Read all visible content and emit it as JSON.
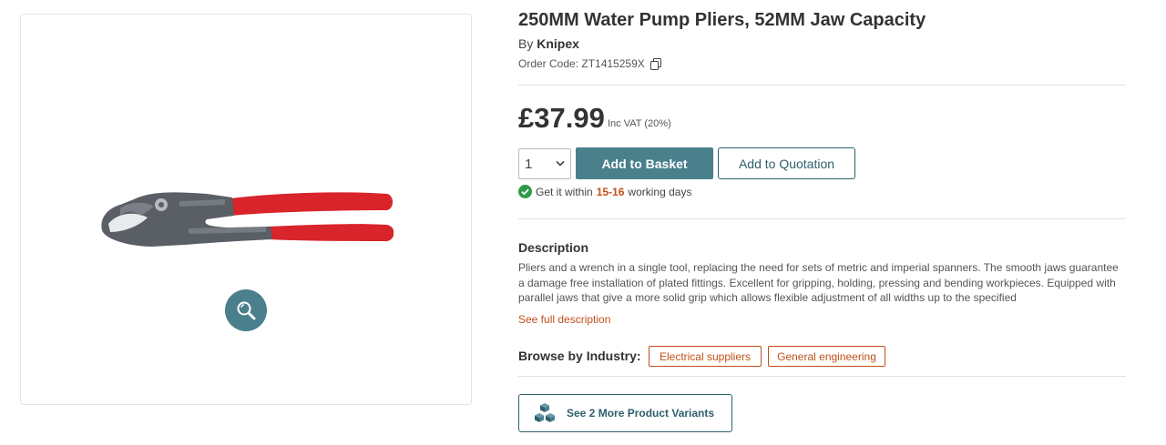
{
  "product": {
    "title": "250MM Water Pump Pliers, 52MM Jaw Capacity",
    "by_label": "By",
    "brand": "Knipex",
    "order_code_label": "Order Code:",
    "order_code": "ZT1415259X",
    "image_icon": "pliers-image",
    "zoom_icon": "magnifier-icon"
  },
  "pricing": {
    "price": "£37.99",
    "vat_note": "Inc VAT (20%)"
  },
  "purchase": {
    "quantity": "1",
    "add_to_basket": "Add to Basket",
    "add_to_quotation": "Add to Quotation"
  },
  "delivery": {
    "prefix": "Get it within",
    "days": "15-16",
    "suffix": "working days"
  },
  "description": {
    "heading": "Description",
    "text": "Pliers and a wrench in a single tool, replacing the need for sets of metric and imperial spanners. The smooth jaws guarantee a damage free installation of plated fittings. Excellent for gripping, holding, pressing and bending workpieces. Equipped with parallel jaws that give a more solid grip which allows flexible adjustment of all widths up to the specified",
    "see_full": "See full description"
  },
  "industry": {
    "label": "Browse by Industry:",
    "tags": [
      "Electrical suppliers",
      "General engineering"
    ]
  },
  "variants": {
    "label": "See 2 More Product Variants"
  },
  "colors": {
    "primary": "#4a7f8c",
    "accent": "#c0501a",
    "success": "#2e9a4a",
    "handle_red": "#d8242a"
  }
}
